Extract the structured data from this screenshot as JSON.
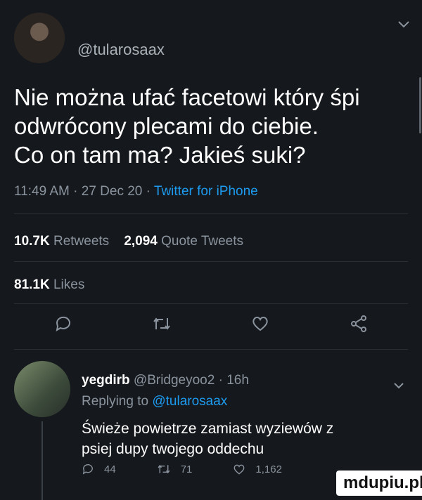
{
  "tweet": {
    "handle": "@tularosaax",
    "text_lines": [
      "Nie można ufać facetowi który śpi",
      "odwrócony plecami do ciebie.",
      "Co on tam ma? Jakieś suki?"
    ],
    "time": "11:49 AM · 27 Dec 20 · ",
    "source": "Twitter for iPhone",
    "retweets_count": "10.7K",
    "retweets_label": "Retweets",
    "quotes_count": "2,094",
    "quotes_label": "Quote Tweets",
    "likes_count": "81.1K",
    "likes_label": "Likes"
  },
  "reply": {
    "name": "yegdirb",
    "handle_time": "@Bridgeyoo2 · 16h",
    "replying_prefix": "Replying to ",
    "replying_to": "@tularosaax",
    "text_lines": [
      "Świeże powietrze zamiast wyziewów z",
      "psiej dupy twojego oddechu"
    ],
    "reply_count": "44",
    "retweet_count": "71",
    "like_count": "1,162"
  },
  "watermark": "mdupiu.pl",
  "colors": {
    "background": "#15181c",
    "link": "#1d9bf0",
    "muted": "#8b949e"
  },
  "icons": [
    "chevron-down-icon",
    "reply-icon",
    "retweet-icon",
    "like-icon",
    "share-icon"
  ]
}
